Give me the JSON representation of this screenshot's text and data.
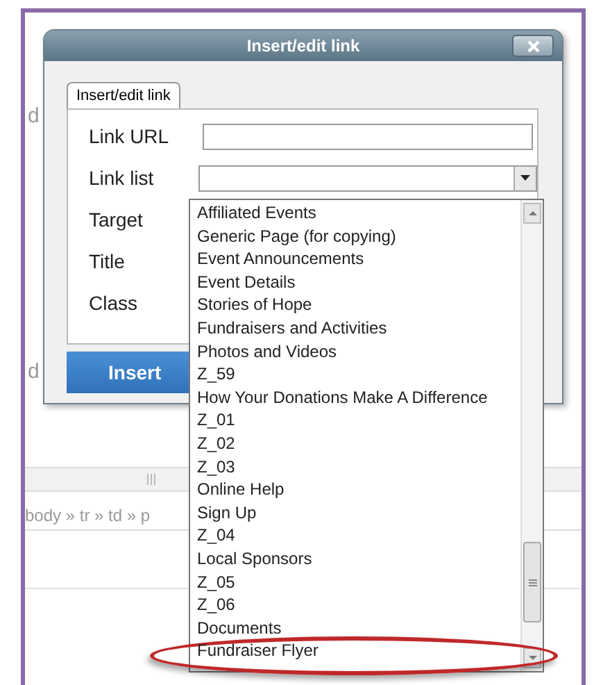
{
  "page": {
    "side_letters": [
      "d",
      "d"
    ],
    "path": "body » tr » td » p"
  },
  "dialog": {
    "title": "Insert/edit link",
    "tabs": [
      {
        "label": "Insert/edit link",
        "selected": true
      }
    ],
    "fields": [
      {
        "label": "Link URL",
        "kind": "input"
      },
      {
        "label": "Link list",
        "kind": "select"
      },
      {
        "label": "Target",
        "kind": "hidden"
      },
      {
        "label": "Title",
        "kind": "hidden"
      },
      {
        "label": "Class",
        "kind": "hidden"
      }
    ],
    "insert_button": "Insert"
  },
  "link_list_dropdown": {
    "items": [
      {
        "label": "Affiliated Events",
        "circled": false
      },
      {
        "label": "Generic Page (for copying)",
        "circled": false
      },
      {
        "label": "Event Announcements",
        "circled": false
      },
      {
        "label": "Event Details",
        "circled": false
      },
      {
        "label": "Stories of Hope",
        "circled": false
      },
      {
        "label": "Fundraisers and Activities",
        "circled": false
      },
      {
        "label": "Photos and Videos",
        "circled": false
      },
      {
        "label": "Z_59",
        "circled": false
      },
      {
        "label": "How Your Donations Make A Difference",
        "circled": false
      },
      {
        "label": "Z_01",
        "circled": false
      },
      {
        "label": "Z_02",
        "circled": false
      },
      {
        "label": "Z_03",
        "circled": false
      },
      {
        "label": "Online Help",
        "circled": false
      },
      {
        "label": "Sign Up",
        "circled": false
      },
      {
        "label": "Z_04",
        "circled": false
      },
      {
        "label": "Local Sponsors",
        "circled": false
      },
      {
        "label": "Z_05",
        "circled": false
      },
      {
        "label": "Z_06",
        "circled": false
      },
      {
        "label": "Documents",
        "circled": false
      },
      {
        "label": "Fundraiser Flyer",
        "circled": true
      }
    ]
  }
}
